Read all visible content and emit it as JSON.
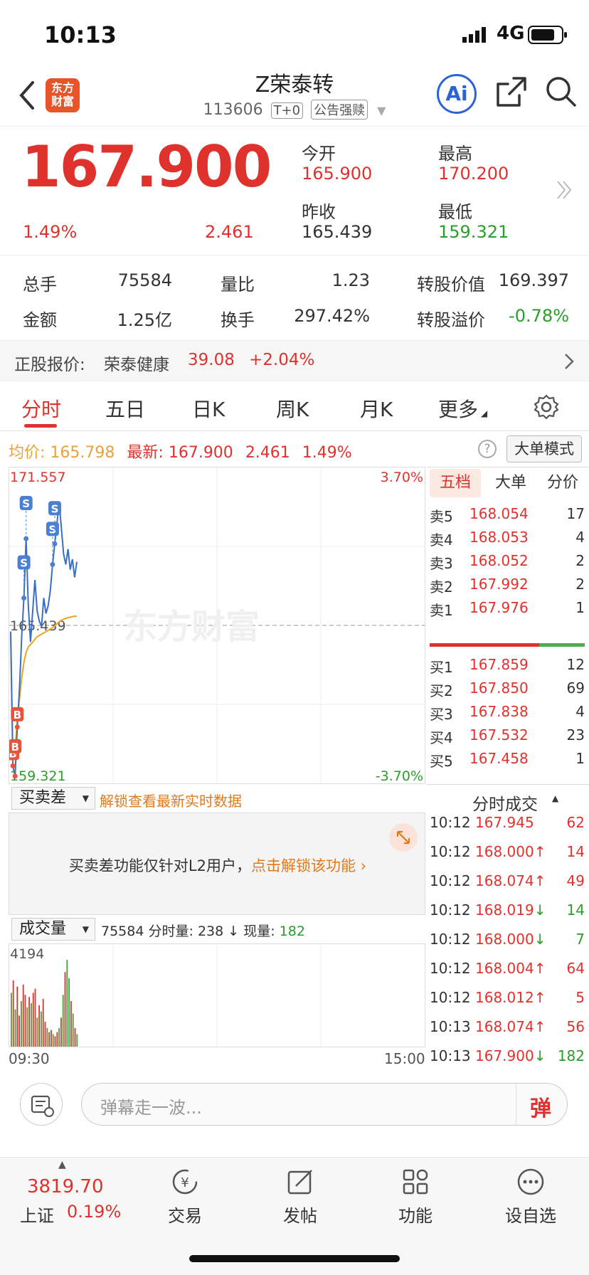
{
  "status": {
    "time": "10:13",
    "network": "4G"
  },
  "header": {
    "title": "Z荣泰转",
    "code": "113606",
    "tag1": "T+0",
    "tag2": "公告强赎",
    "logo_line1": "东方",
    "logo_line2": "财富",
    "ai_label": "Ai"
  },
  "quote": {
    "price": "167.900",
    "change_pct": "1.49%",
    "change": "2.461",
    "open_label": "今开",
    "open": "165.900",
    "high_label": "最高",
    "high": "170.200",
    "prev_label": "昨收",
    "prev": "165.439",
    "low_label": "最低",
    "low": "159.321"
  },
  "stats": {
    "vol_label": "总手",
    "vol": "75584",
    "ratio_label": "量比",
    "ratio": "1.23",
    "conv_val_label": "转股价值",
    "conv_val": "169.397",
    "amt_label": "金额",
    "amt": "1.25亿",
    "turnover_label": "换手",
    "turnover": "297.42%",
    "premium_label": "转股溢价",
    "premium": "-0.78%"
  },
  "underlying": {
    "label": "正股报价:",
    "name": "荣泰健康",
    "price": "39.08",
    "pct": "+2.04%"
  },
  "tabs": [
    "分时",
    "五日",
    "日K",
    "周K",
    "月K",
    "更多"
  ],
  "chart_info": {
    "avg_label": "均价:",
    "avg": "165.798",
    "last_label": "最新:",
    "last": "167.900",
    "chg": "2.461",
    "pct": "1.49%",
    "mode_button": "大单模式"
  },
  "chart_data": {
    "type": "line",
    "y_top": "171.557",
    "y_mid": "165.439",
    "y_bottom": "159.321",
    "pct_top": "3.70%",
    "pct_bottom": "-3.70%",
    "x_start": "09:30",
    "x_end": "15:00",
    "watermark": "东方财富",
    "ylim": [
      159.321,
      171.557
    ],
    "price_series": [
      165.2,
      160.0,
      159.6,
      161.5,
      163.0,
      165.0,
      166.5,
      168.8,
      166.2,
      164.8,
      166.0,
      167.2,
      166.0,
      165.6,
      165.4,
      166.5,
      165.9,
      166.2,
      166.8,
      167.8,
      168.6,
      169.4,
      170.2,
      169.2,
      168.2,
      167.8,
      168.4,
      167.6,
      168.0,
      167.3,
      167.9
    ],
    "avg_series": [
      165.2,
      160.4,
      160.6,
      161.8,
      162.6,
      163.4,
      164.0,
      164.4,
      164.6,
      164.7,
      164.8,
      164.9,
      165.0,
      165.05,
      165.1,
      165.15,
      165.2,
      165.25,
      165.3,
      165.35,
      165.42,
      165.5,
      165.58,
      165.64,
      165.68,
      165.71,
      165.74,
      165.76,
      165.78,
      165.79,
      165.798
    ],
    "markers": [
      {
        "label": "B",
        "i": 1
      },
      {
        "label": "B",
        "i": 2
      },
      {
        "label": "B",
        "i": 3
      },
      {
        "label": "S",
        "i": 6
      },
      {
        "label": "S",
        "i": 7
      },
      {
        "label": "S",
        "i": 19
      },
      {
        "label": "S",
        "i": 20
      }
    ],
    "volume_max": "4194",
    "volume_values": [
      2600,
      3200,
      1800,
      2900,
      1500,
      2200,
      3000,
      2500,
      1900,
      2400,
      2100,
      2600,
      2800,
      1400,
      2000,
      1700,
      2300,
      1200,
      900,
      700,
      800,
      600,
      500,
      700,
      900,
      1400,
      2500,
      3600,
      4194,
      3300,
      2200,
      1600,
      900,
      600
    ],
    "volume_colors": [
      "g",
      "r",
      "g",
      "r",
      "r",
      "g",
      "r",
      "r",
      "g",
      "r",
      "g",
      "r",
      "r",
      "g",
      "r",
      "g",
      "r",
      "r",
      "g",
      "r",
      "r",
      "g",
      "r",
      "r",
      "g",
      "r",
      "g",
      "r",
      "g",
      "g",
      "r",
      "g",
      "r",
      "g"
    ]
  },
  "orderbook": {
    "tabs": [
      "五档",
      "大单",
      "分价"
    ],
    "asks": [
      {
        "k": "卖5",
        "p": "168.054",
        "v": "17"
      },
      {
        "k": "卖4",
        "p": "168.053",
        "v": "4"
      },
      {
        "k": "卖3",
        "p": "168.052",
        "v": "2"
      },
      {
        "k": "卖2",
        "p": "167.992",
        "v": "2"
      },
      {
        "k": "卖1",
        "p": "167.976",
        "v": "1"
      }
    ],
    "bids": [
      {
        "k": "买1",
        "p": "167.859",
        "v": "12"
      },
      {
        "k": "买2",
        "p": "167.850",
        "v": "69"
      },
      {
        "k": "买3",
        "p": "167.838",
        "v": "4"
      },
      {
        "k": "买4",
        "p": "167.532",
        "v": "23"
      },
      {
        "k": "买5",
        "p": "167.458",
        "v": "1"
      }
    ]
  },
  "trades": {
    "title": "分时成交",
    "rows": [
      {
        "t": "10:12",
        "p": "167.945",
        "dir": "",
        "v": "62",
        "c": "red"
      },
      {
        "t": "10:12",
        "p": "168.000",
        "dir": "↑",
        "v": "14",
        "c": "red"
      },
      {
        "t": "10:12",
        "p": "168.074",
        "dir": "↑",
        "v": "49",
        "c": "red"
      },
      {
        "t": "10:12",
        "p": "168.019",
        "dir": "↓",
        "v": "14",
        "c": "green"
      },
      {
        "t": "10:12",
        "p": "168.000",
        "dir": "↓",
        "v": "7",
        "c": "green"
      },
      {
        "t": "10:12",
        "p": "168.004",
        "dir": "↑",
        "v": "64",
        "c": "red"
      },
      {
        "t": "10:12",
        "p": "168.012",
        "dir": "↑",
        "v": "5",
        "c": "red"
      },
      {
        "t": "10:13",
        "p": "168.074",
        "dir": "↑",
        "v": "56",
        "c": "red"
      },
      {
        "t": "10:13",
        "p": "167.900",
        "dir": "↓",
        "v": "182",
        "c": "green"
      }
    ]
  },
  "spread": {
    "select": "买卖差",
    "unlock": "解锁查看最新实时数据",
    "msg": "买卖差功能仅针对L2用户，",
    "msg_link": "点击解锁该功能 ›"
  },
  "volume_bar": {
    "select": "成交量",
    "total": "75584",
    "label1": "分时量:",
    "v1": "238 ↓",
    "label2": "现量:",
    "v2": "182"
  },
  "danmu": {
    "placeholder": "弹幕走一波...",
    "btn": "弹"
  },
  "tabbar": {
    "index_value": "3819.70",
    "index_name": "上证",
    "index_pct": "0.19%",
    "items": [
      "交易",
      "发帖",
      "功能",
      "设自选"
    ]
  }
}
